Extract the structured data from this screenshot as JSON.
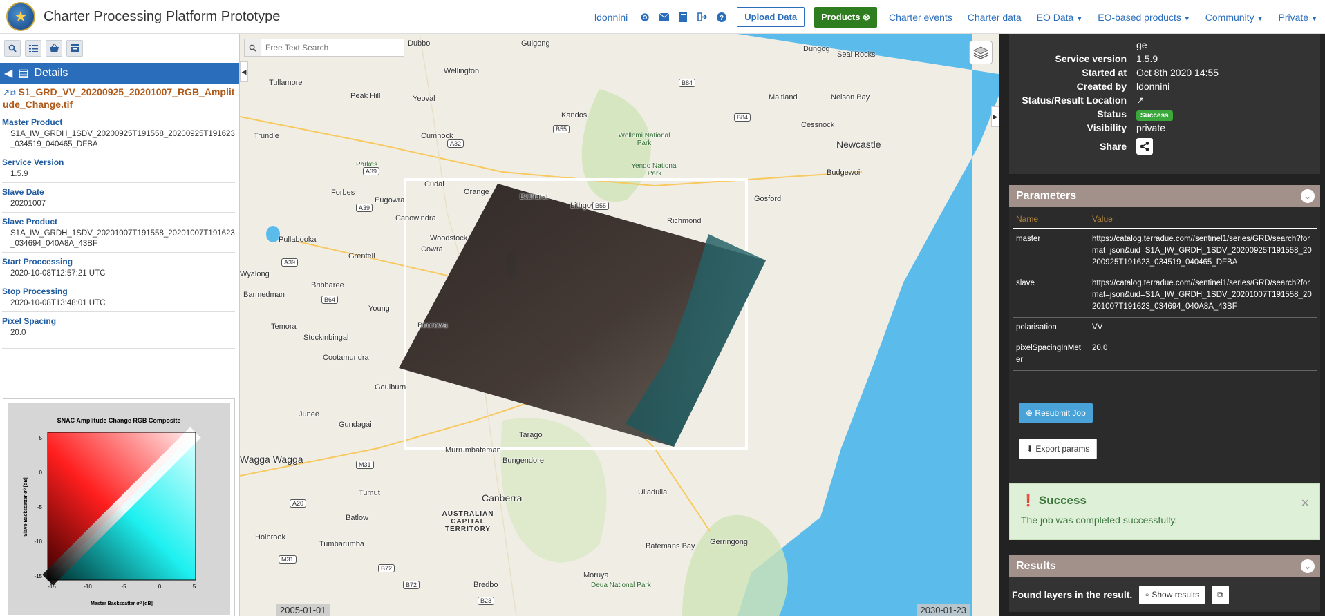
{
  "app": {
    "title": "Charter Processing Platform Prototype"
  },
  "nav": {
    "user": "ldonnini",
    "upload": "Upload Data",
    "products": "Products",
    "charter_events": "Charter events",
    "charter_data": "Charter data",
    "eo_data": "EO Data",
    "eo_products": "EO-based products",
    "community": "Community",
    "private": "Private"
  },
  "details": {
    "header": "Details",
    "filename": "S1_GRD_VV_20200925_20201007_RGB_Amplitude_Change.tif",
    "props": [
      {
        "k": "Master Product",
        "v": "S1A_IW_GRDH_1SDV_20200925T191558_20200925T191623_034519_040465_DFBA"
      },
      {
        "k": "Service Version",
        "v": "1.5.9"
      },
      {
        "k": "Slave Date",
        "v": "20201007"
      },
      {
        "k": "Slave Product",
        "v": "S1A_IW_GRDH_1SDV_20201007T191558_20201007T191623_034694_040A8A_43BF"
      },
      {
        "k": "Start Proccessing",
        "v": "2020-10-08T12:57:21 UTC"
      },
      {
        "k": "Stop Processing",
        "v": "2020-10-08T13:48:01 UTC"
      },
      {
        "k": "Pixel Spacing",
        "v": "20.0"
      }
    ]
  },
  "legend": {
    "title": "SNAC Amplitude Change RGB Composite",
    "ylabel": "Slave Backscatter σ⁰ [dB]",
    "xlabel": "Master Backscatter σ⁰ [dB]",
    "xticks": [
      "-15",
      "-10",
      "-5",
      "0",
      "5"
    ],
    "yticks": [
      "5",
      "0",
      "-5",
      "-10",
      "-15"
    ]
  },
  "map": {
    "search_placeholder": "Free Text Search",
    "date_start": "2005-01-01",
    "date_end": "2030-01-23",
    "labels": [
      {
        "t": "Dubbo"
      },
      {
        "t": "Gulgong"
      },
      {
        "t": "Dungog"
      },
      {
        "t": "Seal Rocks"
      },
      {
        "t": "Wellington"
      },
      {
        "t": "Tullamore"
      },
      {
        "t": "Peak Hill"
      },
      {
        "t": "Yeoval"
      },
      {
        "t": "Maitland"
      },
      {
        "t": "Nelson Bay"
      },
      {
        "t": "Kandos"
      },
      {
        "t": "Cessnock"
      },
      {
        "t": "Trundle"
      },
      {
        "t": "Cumnock"
      },
      {
        "t": "Wollemi National Park"
      },
      {
        "t": "Newcastle"
      },
      {
        "t": "Parkes"
      },
      {
        "t": "Yengo National Park"
      },
      {
        "t": "Budgewoi"
      },
      {
        "t": "Cudal"
      },
      {
        "t": "Forbes"
      },
      {
        "t": "Eugowra"
      },
      {
        "t": "Orange"
      },
      {
        "t": "Bathurst"
      },
      {
        "t": "Lithgow"
      },
      {
        "t": "Gosford"
      },
      {
        "t": "Canowindra"
      },
      {
        "t": "Richmond"
      },
      {
        "t": "Woodstock"
      },
      {
        "t": "Pullabooka"
      },
      {
        "t": "Cowra"
      },
      {
        "t": "Grenfell"
      },
      {
        "t": "Wyalong"
      },
      {
        "t": "Barmedman"
      },
      {
        "t": "Bribbaree"
      },
      {
        "t": "Young"
      },
      {
        "t": "Temora"
      },
      {
        "t": "Boorowa"
      },
      {
        "t": "Stockinbingal"
      },
      {
        "t": "Cootamundra"
      },
      {
        "t": "Gundagai"
      },
      {
        "t": "Junee"
      },
      {
        "t": "Wagga Wagga"
      },
      {
        "t": "Murrumbateman"
      },
      {
        "t": "Tarago"
      },
      {
        "t": "Bungendore"
      },
      {
        "t": "Canberra"
      },
      {
        "t": "Ulladulla"
      },
      {
        "t": "AUSTRALIAN CAPITAL TERRITORY"
      },
      {
        "t": "Tumut"
      },
      {
        "t": "Batlow"
      },
      {
        "t": "Holbrook"
      },
      {
        "t": "Tumbarumba"
      },
      {
        "t": "Batemans Bay"
      },
      {
        "t": "Moruya"
      },
      {
        "t": "Bredbo"
      },
      {
        "t": "Deua National Park"
      },
      {
        "t": "Goulburn"
      },
      {
        "t": "Gerringong"
      }
    ],
    "roads": [
      "B84",
      "B55",
      "A32",
      "A39",
      "A39",
      "A39",
      "B55",
      "B84",
      "B64",
      "M31",
      "A20",
      "M31",
      "B72",
      "B72",
      "B23"
    ]
  },
  "job": {
    "rows": [
      {
        "k": "",
        "v": "ge"
      },
      {
        "k": "Service version",
        "v": "1.5.9"
      },
      {
        "k": "Started at",
        "v": "Oct 8th 2020 14:55"
      },
      {
        "k": "Created by",
        "v": "ldonnini"
      },
      {
        "k": "Status/Result Location",
        "v": ""
      },
      {
        "k": "Status",
        "v": ""
      },
      {
        "k": "Visibility",
        "v": "private"
      }
    ],
    "status_badge": "Success",
    "share_label": "Share"
  },
  "parameters": {
    "title": "Parameters",
    "head_name": "Name",
    "head_value": "Value",
    "rows": [
      {
        "k": "master",
        "v": "https://catalog.terradue.com//sentinel1/series/GRD/search?format=json&uid=S1A_IW_GRDH_1SDV_20200925T191558_20200925T191623_034519_040465_DFBA"
      },
      {
        "k": "slave",
        "v": "https://catalog.terradue.com//sentinel1/series/GRD/search?format=json&uid=S1A_IW_GRDH_1SDV_20201007T191558_20201007T191623_034694_040A8A_43BF"
      },
      {
        "k": "polarisation",
        "v": "VV"
      },
      {
        "k": "pixelSpacingInMeter",
        "v": "20.0"
      }
    ],
    "resubmit": "Resubmit Job",
    "export": "Export params"
  },
  "success": {
    "title": "Success",
    "message": "The job was completed successfully."
  },
  "results": {
    "title": "Results",
    "text": "Found layers in the result.",
    "show": "Show results"
  },
  "colors": {
    "accent": "#2a6ebb",
    "products": "#2e7d1e",
    "panel_head": "#a2908a",
    "success_bg": "#dff0d8"
  }
}
